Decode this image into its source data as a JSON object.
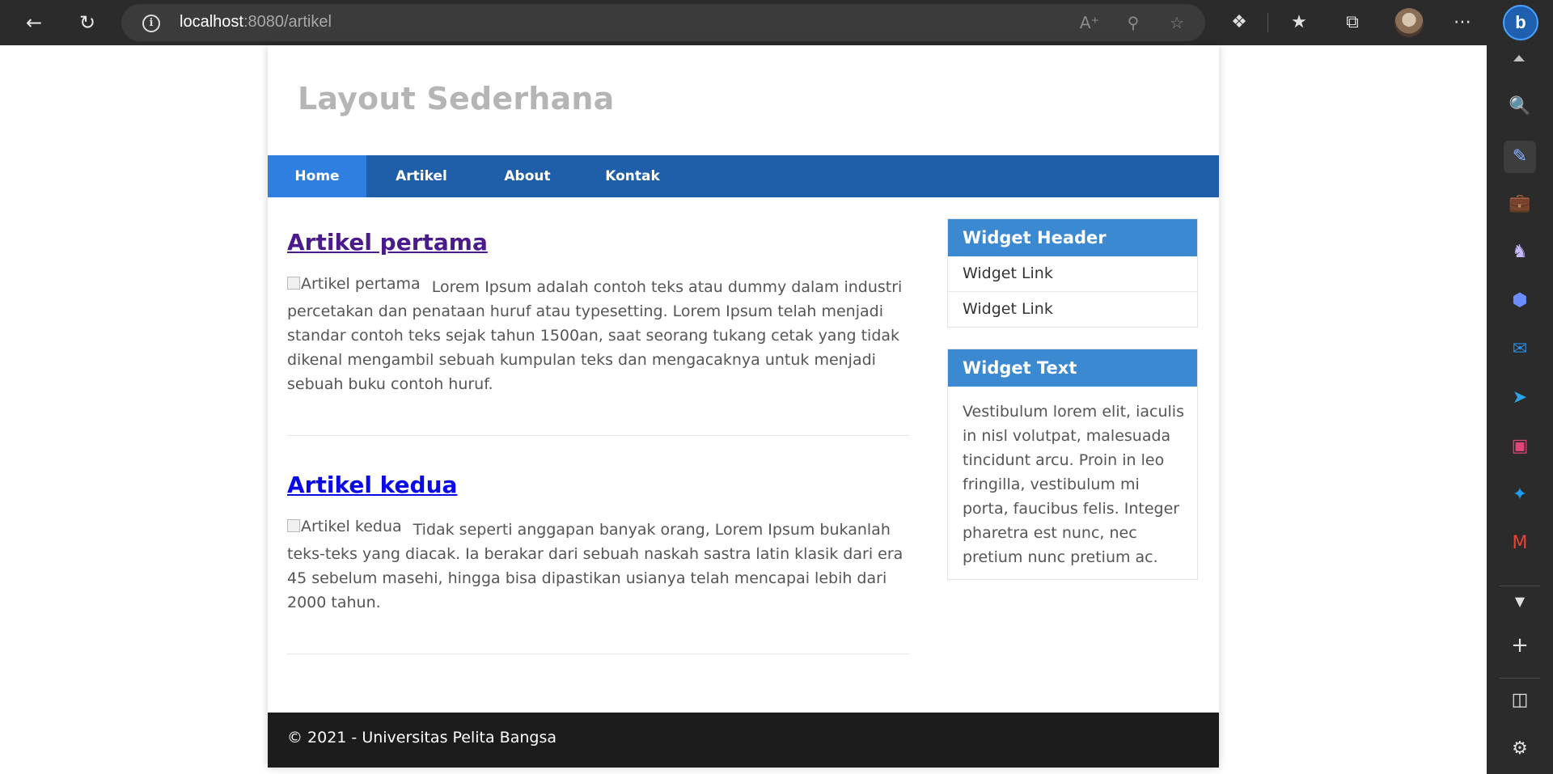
{
  "browser": {
    "url_host": "localhost",
    "url_rest": ":8080/artikel",
    "icons": {
      "back": "back-arrow-icon",
      "reload": "reload-icon",
      "site_info": "info-icon",
      "read_aloud": "read-aloud-icon",
      "zoom": "zoom-out-icon",
      "favorite": "add-favorite-icon",
      "extensions": "extensions-icon",
      "favorites": "favorites-icon",
      "collections": "collections-icon",
      "profile": "profile-avatar",
      "more": "more-icon",
      "bing": "bing-chat-icon"
    },
    "bing_label": "b",
    "info_glyph": "i",
    "sidebar_icons": [
      "search-icon",
      "discover-icon",
      "tools-icon",
      "games-icon",
      "copilot-icon",
      "outlook-icon",
      "telegram-icon",
      "instagram-icon",
      "twitter-icon",
      "gmail-icon",
      "chevron-down-icon",
      "add-icon",
      "split-screen-icon",
      "settings-icon"
    ]
  },
  "site": {
    "title": "Layout Sederhana",
    "nav": [
      {
        "label": "Home",
        "active": true
      },
      {
        "label": "Artikel",
        "active": false
      },
      {
        "label": "About",
        "active": false
      },
      {
        "label": "Kontak",
        "active": false
      }
    ],
    "articles": [
      {
        "title": "Artikel pertama",
        "image_alt": "Artikel pertama",
        "body": "Lorem Ipsum adalah contoh teks atau dummy dalam industri percetakan dan penataan huruf atau typesetting. Lorem Ipsum telah menjadi standar contoh teks sejak tahun 1500an, saat seorang tukang cetak yang tidak dikenal mengambil sebuah kumpulan teks dan mengacaknya untuk menjadi sebuah buku contoh huruf."
      },
      {
        "title": "Artikel kedua",
        "image_alt": "Artikel kedua",
        "body": "Tidak seperti anggapan banyak orang, Lorem Ipsum bukanlah teks-teks yang diacak. Ia berakar dari sebuah naskah sastra latin klasik dari era 45 sebelum masehi, hingga bisa dipastikan usianya telah mencapai lebih dari 2000 tahun."
      }
    ],
    "widgets": {
      "links_header": "Widget Header",
      "links": [
        "Widget Link",
        "Widget Link"
      ],
      "text_header": "Widget Text",
      "text": "Vestibulum lorem elit, iaculis in nisl volutpat, malesuada tincidunt arcu. Proin in leo fringilla, vestibulum mi porta, faucibus felis. Integer pharetra est nunc, nec pretium nunc pretium ac."
    },
    "footer": "© 2021 - Universitas Pelita Bangsa"
  },
  "colors": {
    "nav_bg": "#1f5faa",
    "nav_active": "#2e7fe0",
    "widget_header": "#3b89d0",
    "footer_bg": "#1c1c1c",
    "visited_link": "#4b1a8c",
    "link": "#0a0ae6"
  }
}
